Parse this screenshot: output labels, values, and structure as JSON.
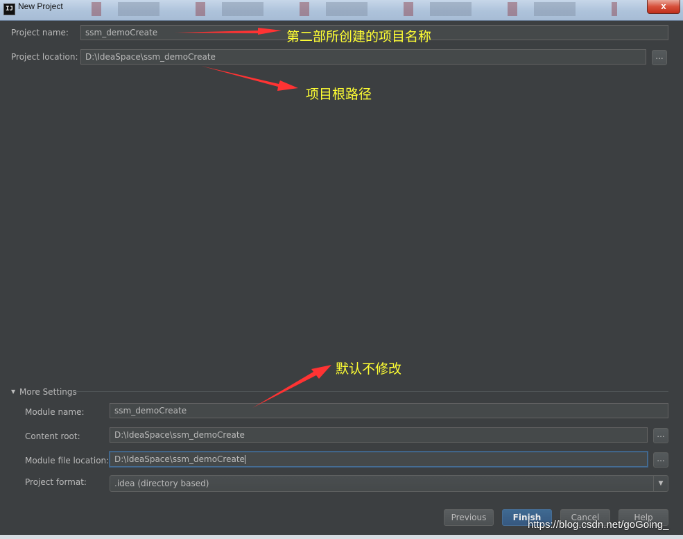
{
  "window": {
    "title": "New Project",
    "app_icon": "IJ",
    "close_label": "x"
  },
  "project_name": {
    "label": "Project name:",
    "value": "ssm_demoCreate"
  },
  "project_location": {
    "label": "Project location:",
    "value": "D:\\IdeaSpace\\ssm_demoCreate",
    "browse_label": "..."
  },
  "more_settings": {
    "toggle_icon": "▼",
    "label": "More Settings",
    "module_name": {
      "label": "Module name:",
      "value": "ssm_demoCreate"
    },
    "content_root": {
      "label": "Content root:",
      "value": "D:\\IdeaSpace\\ssm_demoCreate",
      "browse_label": "..."
    },
    "module_file_location": {
      "label": "Module file location:",
      "value": "D:\\IdeaSpace\\ssm_demoCreate",
      "browse_label": "..."
    },
    "project_format": {
      "label": "Project format:",
      "value": ".idea (directory based)",
      "arrow_icon": "▼"
    }
  },
  "buttons": {
    "previous": "Previous",
    "finish": "Finish",
    "cancel": "Cancel",
    "help": "Help"
  },
  "annotations": {
    "project_name_note": "第二部所创建的项目名称",
    "project_location_note": "项目根路径",
    "more_settings_note": "默认不修改",
    "color": "#ff3333",
    "text_color": "#ffff33"
  },
  "watermark": "https://blog.csdn.net/goGoing_"
}
